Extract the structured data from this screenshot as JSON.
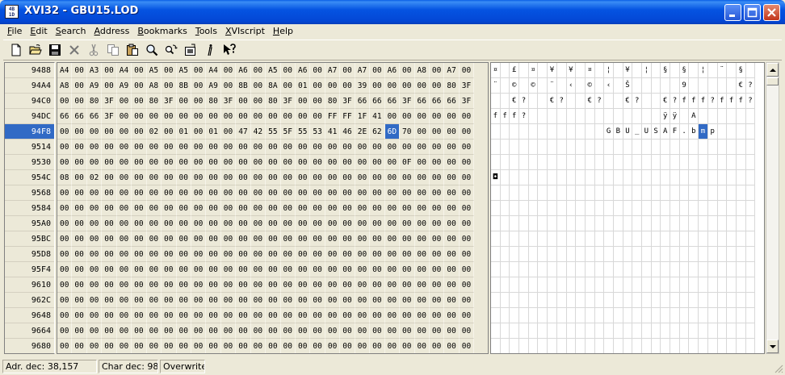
{
  "window": {
    "title": "XVI32 - GBU15.LOD",
    "icon_text": "4B\n1D"
  },
  "menu": [
    "File",
    "Edit",
    "Search",
    "Address",
    "Bookmarks",
    "Tools",
    "XVIscript",
    "Help"
  ],
  "toolbar": [
    "new-file-icon",
    "open-folder-icon",
    "save-disk-icon",
    "delete-x-icon",
    "cut-scissors-icon",
    "copy-icon",
    "paste-clipboard-icon",
    "find-magnifier-icon",
    "replace-icon",
    "properties-icon",
    "info-icon",
    "context-help-icon"
  ],
  "addresses": [
    "9488",
    "94A4",
    "94C0",
    "94DC",
    "94F8",
    "9514",
    "9530",
    "954C",
    "9568",
    "9584",
    "95A0",
    "95BC",
    "95D8",
    "95F4",
    "9610",
    "962C",
    "9648",
    "9664",
    "9680"
  ],
  "selected_row": 4,
  "selected_col": 22,
  "hex_rows": [
    "A4 00 A3 00 A4 00 A5 00 A5 00 A4 00 A6 00 A5 00 A6 00 A7 00 A7 00 A6 00 A8 00 A7 00",
    "A8 00 A9 00 A9 00 A8 00 8B 00 A9 00 8B 00 8A 00 01 00 00 00 39 00 00 00 00 00 80 3F",
    "00 00 80 3F 00 00 80 3F 00 00 80 3F 00 00 80 3F 00 00 80 3F 66 66 66 3F 66 66 66 3F",
    "66 66 66 3F 00 00 00 00 00 00 00 00 00 00 00 00 00 00 FF FF 1F 41 00 00 00 00 00 00",
    "00 00 00 00 00 00 02 00 01 00 01 00 47 42 55 5F 55 53 41 46 2E 62 6D 70 00 00 00 00",
    "00 00 00 00 00 00 00 00 00 00 00 00 00 00 00 00 00 00 00 00 00 00 00 00 00 00 00 00",
    "00 00 00 00 00 00 00 00 00 00 00 00 00 00 00 00 00 00 00 00 00 00 00 0F 00 00 00 00",
    "08 00 02 00 00 00 00 00 00 00 00 00 00 00 00 00 00 00 00 00 00 00 00 00 00 00 00 00",
    "00 00 00 00 00 00 00 00 00 00 00 00 00 00 00 00 00 00 00 00 00 00 00 00 00 00 00 00",
    "00 00 00 00 00 00 00 00 00 00 00 00 00 00 00 00 00 00 00 00 00 00 00 00 00 00 00 00",
    "00 00 00 00 00 00 00 00 00 00 00 00 00 00 00 00 00 00 00 00 00 00 00 00 00 00 00 00",
    "00 00 00 00 00 00 00 00 00 00 00 00 00 00 00 00 00 00 00 00 00 00 00 00 00 00 00 00",
    "00 00 00 00 00 00 00 00 00 00 00 00 00 00 00 00 00 00 00 00 00 00 00 00 00 00 00 00",
    "00 00 00 00 00 00 00 00 00 00 00 00 00 00 00 00 00 00 00 00 00 00 00 00 00 00 00 00",
    "00 00 00 00 00 00 00 00 00 00 00 00 00 00 00 00 00 00 00 00 00 00 00 00 00 00 00 00",
    "00 00 00 00 00 00 00 00 00 00 00 00 00 00 00 00 00 00 00 00 00 00 00 00 00 00 00 00",
    "00 00 00 00 00 00 00 00 00 00 00 00 00 00 00 00 00 00 00 00 00 00 00 00 00 00 00 00",
    "00 00 00 00 00 00 00 00 00 00 00 00 00 00 00 00 00 00 00 00 00 00 00 00 00 00 00 00",
    "00 00 00 00 00 00 00 00 00 00 00 00 00 00 00 00 00 00 00 00 00 00 00 00 00 00 00 00"
  ],
  "char_rows": [
    [
      "¤",
      "",
      "£",
      "",
      "¤",
      "",
      "¥",
      "",
      "¥",
      "",
      "¤",
      "",
      "¦",
      "",
      "¥",
      "",
      "¦",
      "",
      "§",
      "",
      "§",
      "",
      "¦",
      "",
      "¨",
      "",
      "§",
      ""
    ],
    [
      "¨",
      "",
      "©",
      "",
      "©",
      "",
      "¨",
      "",
      "‹",
      "",
      "©",
      "",
      "‹",
      "",
      "Š",
      "",
      "",
      "",
      "",
      "",
      "9",
      "",
      "",
      "",
      "",
      "",
      "€",
      "?"
    ],
    [
      "",
      "",
      "€",
      "?",
      "",
      "",
      "€",
      "?",
      "",
      "",
      "€",
      "?",
      "",
      "",
      "€",
      "?",
      "",
      "",
      "€",
      "?",
      "f",
      "f",
      "f",
      "?",
      "f",
      "f",
      "f",
      "?"
    ],
    [
      "f",
      "f",
      "f",
      "?",
      "",
      "",
      "",
      "",
      "",
      "",
      "",
      "",
      "",
      "",
      "",
      "",
      "",
      "",
      "ÿ",
      "ÿ",
      "",
      "A",
      "",
      "",
      "",
      "",
      "",
      ""
    ],
    [
      "",
      "",
      "",
      "",
      "",
      "",
      "",
      "",
      "",
      "",
      "",
      "",
      "G",
      "B",
      "U",
      "_",
      "U",
      "S",
      "A",
      "F",
      ".",
      "b",
      "m",
      "p",
      "",
      "",
      "",
      ""
    ],
    [
      "",
      "",
      "",
      "",
      "",
      "",
      "",
      "",
      "",
      "",
      "",
      "",
      "",
      "",
      "",
      "",
      "",
      "",
      "",
      "",
      "",
      "",
      "",
      "",
      "",
      "",
      "",
      ""
    ],
    [
      "",
      "",
      "",
      "",
      "",
      "",
      "",
      "",
      "",
      "",
      "",
      "",
      "",
      "",
      "",
      "",
      "",
      "",
      "",
      "",
      "",
      "",
      "",
      "",
      "",
      "",
      "",
      ""
    ],
    [
      "◘",
      "",
      "",
      "",
      "",
      "",
      "",
      "",
      "",
      "",
      "",
      "",
      "",
      "",
      "",
      "",
      "",
      "",
      "",
      "",
      "",
      "",
      "",
      "",
      "",
      "",
      "",
      ""
    ],
    [
      "",
      "",
      "",
      "",
      "",
      "",
      "",
      "",
      "",
      "",
      "",
      "",
      "",
      "",
      "",
      "",
      "",
      "",
      "",
      "",
      "",
      "",
      "",
      "",
      "",
      "",
      "",
      ""
    ],
    [
      "",
      "",
      "",
      "",
      "",
      "",
      "",
      "",
      "",
      "",
      "",
      "",
      "",
      "",
      "",
      "",
      "",
      "",
      "",
      "",
      "",
      "",
      "",
      "",
      "",
      "",
      "",
      ""
    ],
    [
      "",
      "",
      "",
      "",
      "",
      "",
      "",
      "",
      "",
      "",
      "",
      "",
      "",
      "",
      "",
      "",
      "",
      "",
      "",
      "",
      "",
      "",
      "",
      "",
      "",
      "",
      "",
      ""
    ],
    [
      "",
      "",
      "",
      "",
      "",
      "",
      "",
      "",
      "",
      "",
      "",
      "",
      "",
      "",
      "",
      "",
      "",
      "",
      "",
      "",
      "",
      "",
      "",
      "",
      "",
      "",
      "",
      ""
    ],
    [
      "",
      "",
      "",
      "",
      "",
      "",
      "",
      "",
      "",
      "",
      "",
      "",
      "",
      "",
      "",
      "",
      "",
      "",
      "",
      "",
      "",
      "",
      "",
      "",
      "",
      "",
      "",
      ""
    ],
    [
      "",
      "",
      "",
      "",
      "",
      "",
      "",
      "",
      "",
      "",
      "",
      "",
      "",
      "",
      "",
      "",
      "",
      "",
      "",
      "",
      "",
      "",
      "",
      "",
      "",
      "",
      "",
      ""
    ],
    [
      "",
      "",
      "",
      "",
      "",
      "",
      "",
      "",
      "",
      "",
      "",
      "",
      "",
      "",
      "",
      "",
      "",
      "",
      "",
      "",
      "",
      "",
      "",
      "",
      "",
      "",
      "",
      ""
    ],
    [
      "",
      "",
      "",
      "",
      "",
      "",
      "",
      "",
      "",
      "",
      "",
      "",
      "",
      "",
      "",
      "",
      "",
      "",
      "",
      "",
      "",
      "",
      "",
      "",
      "",
      "",
      "",
      ""
    ],
    [
      "",
      "",
      "",
      "",
      "",
      "",
      "",
      "",
      "",
      "",
      "",
      "",
      "",
      "",
      "",
      "",
      "",
      "",
      "",
      "",
      "",
      "",
      "",
      "",
      "",
      "",
      "",
      ""
    ],
    [
      "",
      "",
      "",
      "",
      "",
      "",
      "",
      "",
      "",
      "",
      "",
      "",
      "",
      "",
      "",
      "",
      "",
      "",
      "",
      "",
      "",
      "",
      "",
      "",
      "",
      "",
      "",
      ""
    ],
    [
      "",
      "",
      "",
      "",
      "",
      "",
      "",
      "",
      "",
      "",
      "",
      "",
      "",
      "",
      "",
      "",
      "",
      "",
      "",
      "",
      "",
      "",
      "",
      "",
      "",
      "",
      "",
      ""
    ]
  ],
  "status": {
    "address": "Adr. dec: 38,157",
    "char": "Char dec: 98",
    "mode": "Overwrite"
  }
}
